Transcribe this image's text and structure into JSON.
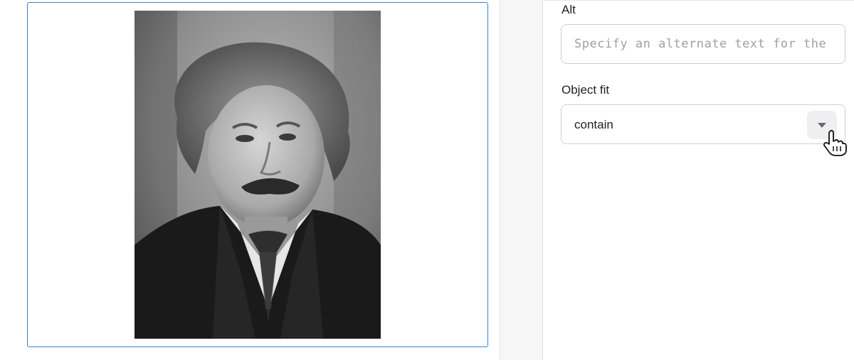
{
  "canvas": {
    "image": {
      "subject": "black-and-white portrait photo",
      "frame_color": "#3b7fd4"
    }
  },
  "panel": {
    "alt": {
      "label": "Alt",
      "value": "",
      "placeholder": "Specify an alternate text for the"
    },
    "object_fit": {
      "label": "Object fit",
      "selected": "contain",
      "toggle_icon": "chevron-down-icon"
    }
  },
  "pointer": {
    "icon": "hand-pointer-icon"
  }
}
